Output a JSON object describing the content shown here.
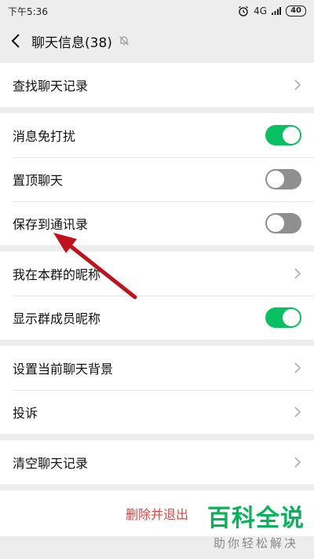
{
  "status_bar": {
    "time": "下午5:36",
    "alarm_icon": "alarm-icon",
    "network": "4G",
    "battery": "40"
  },
  "nav": {
    "title": "聊天信息(38)",
    "back_icon": "chevron-left-icon",
    "mute_icon": "bell-off-icon"
  },
  "groups": {
    "search": {
      "label": "查找聊天记录"
    },
    "settings": {
      "mute_label": "消息免打扰",
      "mute_on": true,
      "pin_label": "置顶聊天",
      "pin_on": false,
      "save_label": "保存到通讯录",
      "save_on": false
    },
    "nickname": {
      "my_nickname_label": "我在本群的昵称",
      "show_nicknames_label": "显示群成员昵称",
      "show_nicknames_on": true
    },
    "misc": {
      "background_label": "设置当前聊天背景",
      "complaint_label": "投诉"
    },
    "clear": {
      "label": "清空聊天记录"
    }
  },
  "exit": {
    "label": "删除并退出"
  },
  "watermark": {
    "main": "百科全说",
    "sub": "助你轻松解决"
  },
  "colors": {
    "switch_on": "#07c160",
    "danger": "#e64340",
    "arrow": "#c0121c"
  }
}
